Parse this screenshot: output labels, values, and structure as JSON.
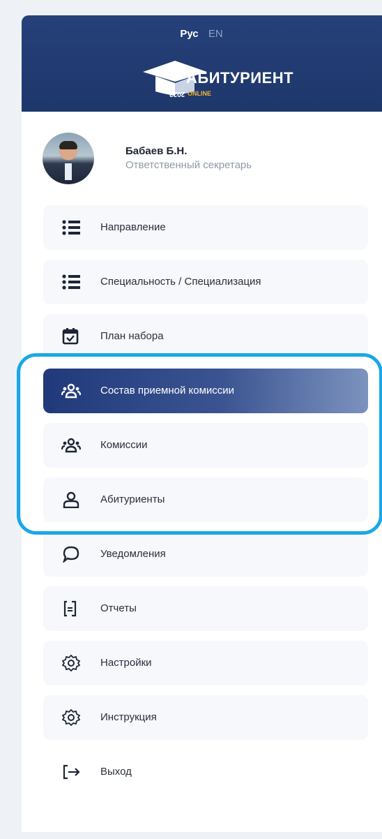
{
  "header": {
    "lang_ru": "Рус",
    "lang_en": "EN",
    "logo_title": "АБИТУРИЕНТ",
    "logo_online": "ONLINE",
    "logo_year": "2022"
  },
  "profile": {
    "name": "Бабаев Б.Н.",
    "role": "Ответственный секретарь"
  },
  "menu": [
    {
      "label": "Направление",
      "icon": "list-icon"
    },
    {
      "label": "Специальность / Специализация",
      "icon": "list-icon"
    },
    {
      "label": "План набора",
      "icon": "calendar-check-icon"
    },
    {
      "label": "Состав приемной комиссии",
      "icon": "users-group-icon",
      "active": true
    },
    {
      "label": "Комиссии",
      "icon": "users-group-icon"
    },
    {
      "label": "Абитуриенты",
      "icon": "user-icon"
    },
    {
      "label": "Уведомления",
      "icon": "chat-bubble-icon"
    },
    {
      "label": "Отчеты",
      "icon": "document-icon"
    },
    {
      "label": "Настройки",
      "icon": "gear-icon"
    },
    {
      "label": "Инструкция",
      "icon": "gear-icon"
    },
    {
      "label": "Выход",
      "icon": "logout-icon"
    }
  ],
  "colors": {
    "header_bg": "#223c75",
    "active_item": "#20397a",
    "highlight_border": "#1aa7e8",
    "logo_accent": "#f5b332"
  }
}
